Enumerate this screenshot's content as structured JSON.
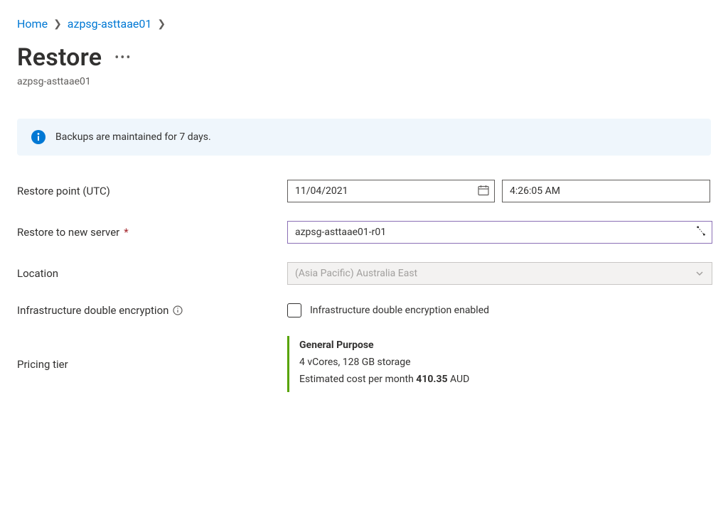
{
  "breadcrumb": {
    "home": "Home",
    "resource": "azpsg-asttaae01"
  },
  "page": {
    "title": "Restore",
    "subtitle": "azpsg-asttaae01"
  },
  "info": {
    "message": "Backups are maintained for 7 days."
  },
  "form": {
    "restore_point_label": "Restore point (UTC)",
    "restore_date": "11/04/2021",
    "restore_time": "4:26:05 AM",
    "new_server_label": "Restore to new server",
    "new_server_value": "azpsg-asttaae01-r01",
    "location_label": "Location",
    "location_value": "(Asia Pacific) Australia East",
    "encryption_label": "Infrastructure double encryption",
    "encryption_cb_label": "Infrastructure double encryption enabled",
    "pricing_label": "Pricing tier"
  },
  "pricing": {
    "tier_name": "General Purpose",
    "spec": "4 vCores, 128 GB storage",
    "cost_prefix": "Estimated cost per month ",
    "cost_value": "410.35",
    "cost_currency": " AUD"
  }
}
